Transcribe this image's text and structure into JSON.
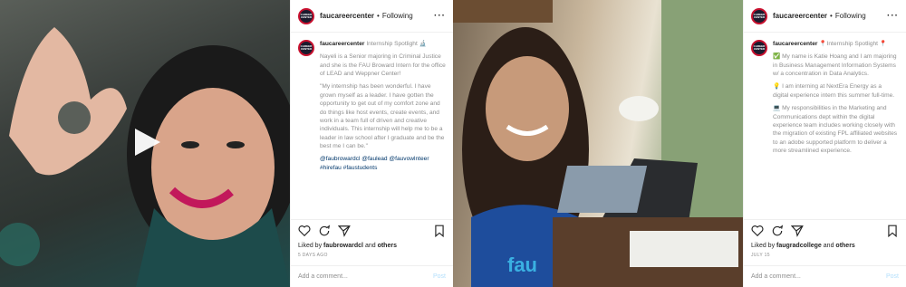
{
  "posts": [
    {
      "username": "faucareercenter",
      "follow": "Following",
      "caption_title": "Internship Spotlight",
      "caption_paragraphs": [
        "Nayeli is a Senior majoring in Criminal Justice and she is the FAU Broward Intern for the office of LEAD and Weppner Center!",
        "\"My internship has been wonderful. I have grown myself as a leader. I have gotten the opportunity to get out of my comfort zone and do things like host events, create events, and work in a team full of driven and creative individuals. This internship will help me to be a leader in law school after I graduate and be the best me I can be.\""
      ],
      "tags": "@faubrowardcl @faulead @fauvowlnteer #hirefau #faustudents",
      "liked_by_prefix": "Liked by",
      "liked_by_user": "faubrowardcl",
      "liked_by_suffix": "and",
      "liked_by_others": "others",
      "date": "5 DAYS AGO",
      "comment_placeholder": "Add a comment...",
      "post_label": "Post"
    },
    {
      "username": "faucareercenter",
      "follow": "Following",
      "caption_title": "Internship Spotlight",
      "caption_paragraphs": [
        "My name is Katie Hoang and I am majoring in Business Management Information Systems w/ a concentration in Data Analytics.",
        "I am interning at NextEra Energy as a digital experience intern this summer full-time.",
        "My responsibilities in the Marketing and Communications dept within the digital experience team includes working closely with the migration of existing FPL affiliated websites to an adobe supported platform to deliver a more streamlined experience."
      ],
      "tags": "",
      "liked_by_prefix": "Liked by",
      "liked_by_user": "faugradcollege",
      "liked_by_suffix": "and",
      "liked_by_others": "others",
      "date": "JULY 15",
      "comment_placeholder": "Add a comment...",
      "post_label": "Post"
    }
  ],
  "avatar_text": "CAREER CENTER",
  "colors": {
    "accent": "#c8102e",
    "link": "#00376b",
    "muted": "#8e8e8e"
  },
  "icons": [
    "heart-icon",
    "comment-icon",
    "share-icon",
    "bookmark-icon",
    "play-icon",
    "more-icon"
  ]
}
